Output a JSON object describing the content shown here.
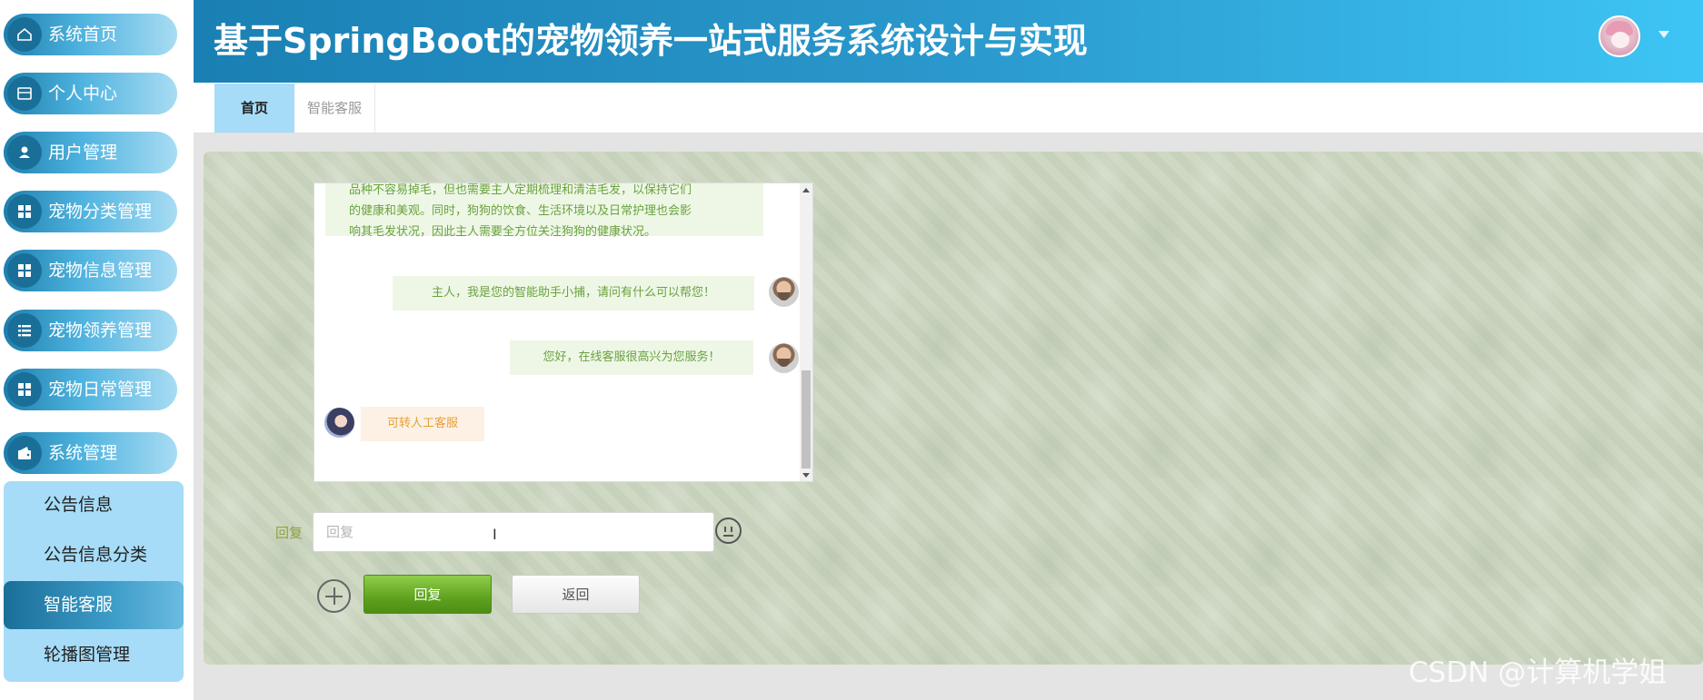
{
  "header": {
    "title": "基于SpringBoot的宠物领养一站式服务系统设计与实现"
  },
  "sidebar": {
    "items": [
      {
        "label": "系统首页",
        "icon": "home-icon"
      },
      {
        "label": "个人中心",
        "icon": "card-icon"
      },
      {
        "label": "用户管理",
        "icon": "user-icon"
      },
      {
        "label": "宠物分类管理",
        "icon": "grid-icon"
      },
      {
        "label": "宠物信息管理",
        "icon": "grid-icon"
      },
      {
        "label": "宠物领养管理",
        "icon": "list-icon"
      },
      {
        "label": "宠物日常管理",
        "icon": "grid-icon"
      },
      {
        "label": "系统管理",
        "icon": "wallet-icon"
      }
    ],
    "submenu": [
      {
        "label": "公告信息"
      },
      {
        "label": "公告信息分类"
      },
      {
        "label": "智能客服",
        "active": true
      },
      {
        "label": "轮播图管理"
      }
    ]
  },
  "tabs": [
    {
      "label": "首页",
      "active": true
    },
    {
      "label": "智能客服",
      "active": false
    }
  ],
  "chat": {
    "messages": [
      {
        "side": "left",
        "lines": [
          "品种不容易掉毛，但也需要主人定期梳理和清洁毛发，以保持它们",
          "的健康和美观。同时，狗狗的饮食、生活环境以及日常护理也会影",
          "响其毛发状况，因此主人需要全方位关注狗狗的健康状况。"
        ]
      },
      {
        "side": "right",
        "text": "主人，我是您的智能助手小捕，请问有什么可以帮您！"
      },
      {
        "side": "right",
        "text": "您好，在线客服很高兴为您服务！"
      },
      {
        "side": "left",
        "text": "可转人工客服"
      }
    ]
  },
  "reply": {
    "label": "回复",
    "placeholder": "回复",
    "submit_label": "回复",
    "back_label": "返回"
  },
  "watermark": "CSDN @计算机学姐",
  "colors": {
    "accent": "#1a80b4",
    "menu_active": "#1a6f98",
    "bubble_green_text": "#6aa23f",
    "bubble_orange_text": "#e6a03a",
    "reply_button": "#5ea21f"
  }
}
